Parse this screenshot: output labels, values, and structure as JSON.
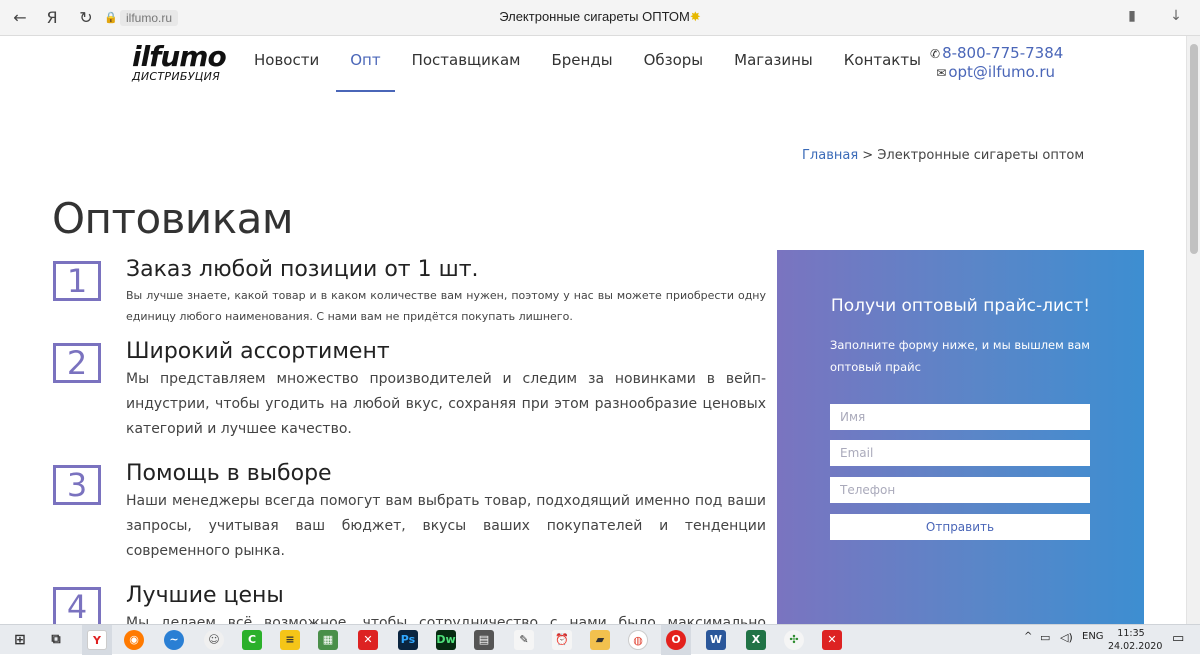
{
  "browser": {
    "back_glyph": "←",
    "yandex_glyph": "Я",
    "reload_glyph": "↻",
    "lock_glyph": "🔒",
    "url": "ilfumo.ru",
    "tab_title": "Электронные сигареты ОПТОМ",
    "title_spark": "✸",
    "bookmark_glyph": "▮",
    "download_glyph": "↓"
  },
  "site": {
    "logo_word": "ilfumo",
    "logo_sub": "ДИСТРИБУЦИЯ",
    "menu": [
      {
        "label": "Новости"
      },
      {
        "label": "Опт"
      },
      {
        "label": "Поставщикам"
      },
      {
        "label": "Бренды"
      },
      {
        "label": "Обзоры"
      },
      {
        "label": "Магазины"
      },
      {
        "label": "Контакты"
      }
    ],
    "active_menu": "Опт",
    "phone_icon": "✆",
    "phone": "8-800-775-7384",
    "email_icon": "✉",
    "email": "opt@ilfumo.ru"
  },
  "breadcrumb": {
    "home": "Главная",
    "sep": ">",
    "current": "Электронные сигареты оптом"
  },
  "page_title": "Оптовикам",
  "features": [
    {
      "num": "1",
      "title": "Заказ любой позиции от 1 шт.",
      "text": "Вы лучше знаете, какой товар и в каком количестве вам нужен, поэтому у нас вы можете приобрести одну единицу любого наименования. С нами вам не придётся покупать лишнего."
    },
    {
      "num": "2",
      "title": "Широкий ассортимент",
      "text": "Мы представляем множество производителей и следим за новинками в вейп-индустрии, чтобы угодить на любой вкус, сохраняя при этом разнообразие ценовых категорий и лучшее качество."
    },
    {
      "num": "3",
      "title": "Помощь в выборе",
      "text": "Наши менеджеры всегда помогут вам выбрать товар, подходящий именно под ваши запросы, учитывая ваш бюджет, вкусы ваших покупателей и тенденции современного рынка."
    },
    {
      "num": "4",
      "title": "Лучшие цены",
      "text": "Мы делаем всё возможное, чтобы сотрудничество с нами было максимально выгодным для"
    }
  ],
  "form": {
    "title": "Получи оптовый прайс-лист!",
    "description": "Заполните форму ниже, и мы вышлем вам оптовый прайс",
    "name_placeholder": "Имя",
    "email_placeholder": "Email",
    "phone_placeholder": "Телефон",
    "submit_label": "Отправить",
    "gradient_start": "#7a74c0",
    "gradient_end": "#3d8ed1"
  },
  "taskbar": {
    "tray_lang": "ENG",
    "tray_caret": "^",
    "time": "11:35",
    "date": "24.02.2020"
  }
}
